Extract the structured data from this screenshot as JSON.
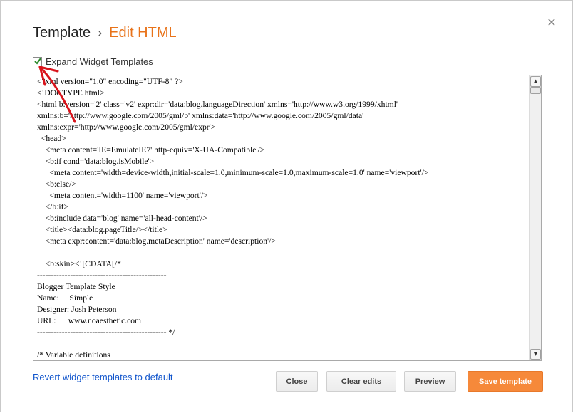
{
  "dialog": {
    "title": "Template",
    "separator": "›",
    "subtitle": "Edit HTML",
    "close_icon": "close-icon"
  },
  "expand": {
    "label": "Expand Widget Templates",
    "checked": true
  },
  "editor": {
    "lines": [
      "<?xml version=\"1.0\" encoding=\"UTF-8\" ?>",
      "<!DOCTYPE html>",
      "<html b:version='2' class='v2' expr:dir='data:blog.languageDirection' xmlns='http://www.w3.org/1999/xhtml'",
      "xmlns:b='http://www.google.com/2005/gml/b' xmlns:data='http://www.google.com/2005/gml/data'",
      "xmlns:expr='http://www.google.com/2005/gml/expr'>",
      "  <head>",
      "    <meta content='IE=EmulateIE7' http-equiv='X-UA-Compatible'/>",
      "    <b:if cond='data:blog.isMobile'>",
      "      <meta content='width=device-width,initial-scale=1.0,minimum-scale=1.0,maximum-scale=1.0' name='viewport'/>",
      "    <b:else/>",
      "      <meta content='width=1100' name='viewport'/>",
      "    </b:if>",
      "    <b:include data='blog' name='all-head-content'/>",
      "    <title><data:blog.pageTitle/></title>",
      "    <meta expr:content='data:blog.metaDescription' name='description'/>",
      "",
      "    <b:skin><![CDATA[/*",
      "-----------------------------------------------",
      "Blogger Template Style",
      "Name:     Simple",
      "Designer: Josh Peterson",
      "URL:      www.noaesthetic.com",
      "----------------------------------------------- */",
      "",
      "/* Variable definitions"
    ]
  },
  "footer": {
    "revert_link": "Revert widget templates to default",
    "close_button": "Close",
    "clear_button": "Clear edits",
    "preview_button": "Preview",
    "save_button": "Save template"
  },
  "colors": {
    "accent": "#e8731a",
    "save_button": "#f6893a",
    "link": "#1155cc",
    "annotation_arrow": "#d9141c"
  }
}
